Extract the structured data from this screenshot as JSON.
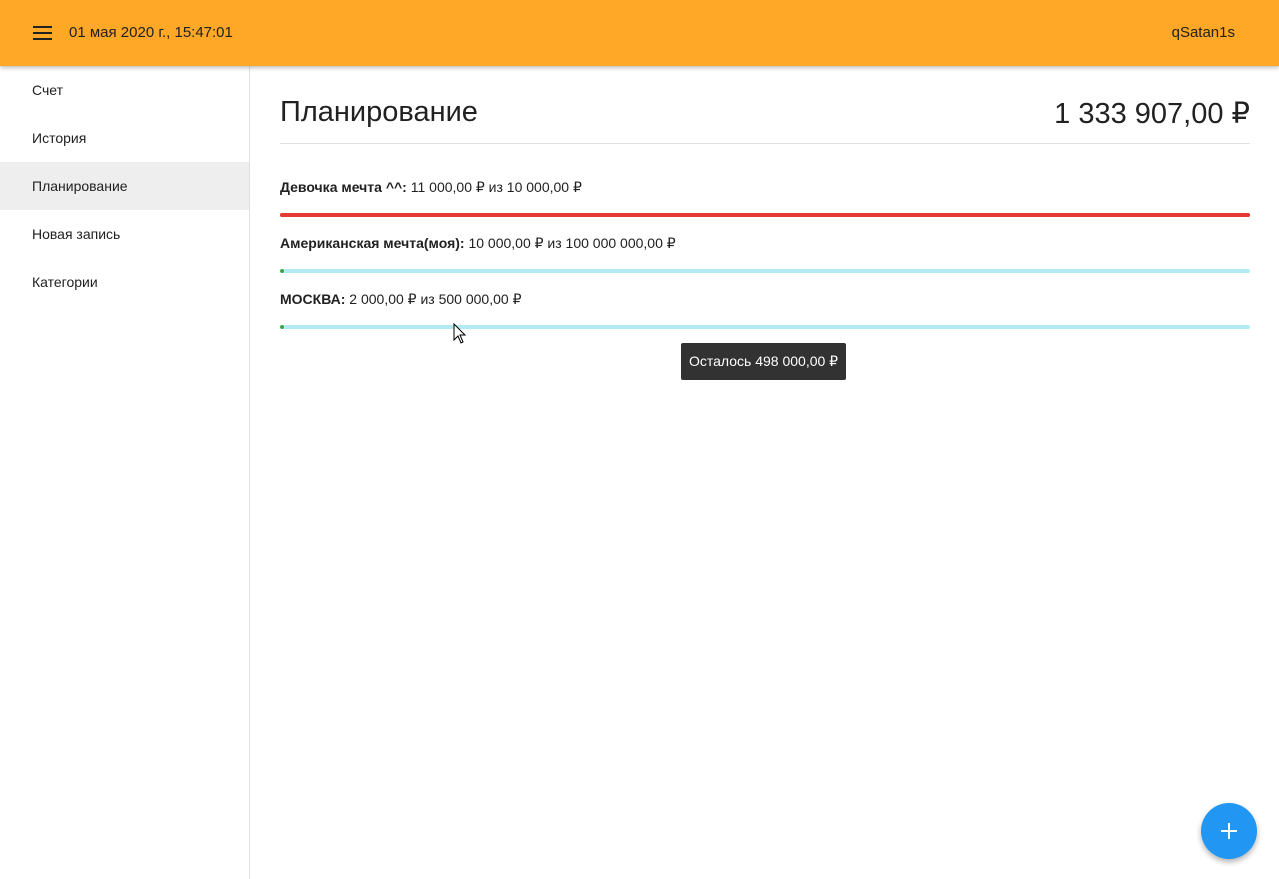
{
  "header": {
    "datetime": "01 мая 2020 г., 15:47:01",
    "username": "qSatan1s",
    "menu_icon": "hamburger-menu-icon",
    "background": "#ffa726"
  },
  "sidebar": {
    "items": [
      {
        "label": "Счет",
        "active": false
      },
      {
        "label": "История",
        "active": false
      },
      {
        "label": "Планирование",
        "active": true
      },
      {
        "label": "Новая запись",
        "active": false
      },
      {
        "label": "Категории",
        "active": false
      }
    ]
  },
  "page": {
    "title": "Планирование",
    "balance": "1 333 907,00 ₽"
  },
  "plans": [
    {
      "name": "Девочка мечта ^^:",
      "detail": "11 000,00 ₽ из 10 000,00 ₽",
      "progress": 1.0,
      "fill_color": "#e53935",
      "track_color": "#e53935"
    },
    {
      "name": "Американская мечта(моя):",
      "detail": "10 000,00 ₽ из 100 000 000,00 ₽",
      "progress": 0.0001,
      "fill_color": "#43a047",
      "track_color": "#b2ebf2"
    },
    {
      "name": "МОСКВА:",
      "detail": "2 000,00 ₽ из 500 000,00 ₽",
      "progress": 0.004,
      "fill_color": "#43a047",
      "track_color": "#b2ebf2"
    }
  ],
  "tooltip": {
    "text": "Осталось 498 000,00 ₽"
  },
  "fab": {
    "icon": "plus-icon",
    "color": "#2196f3"
  }
}
